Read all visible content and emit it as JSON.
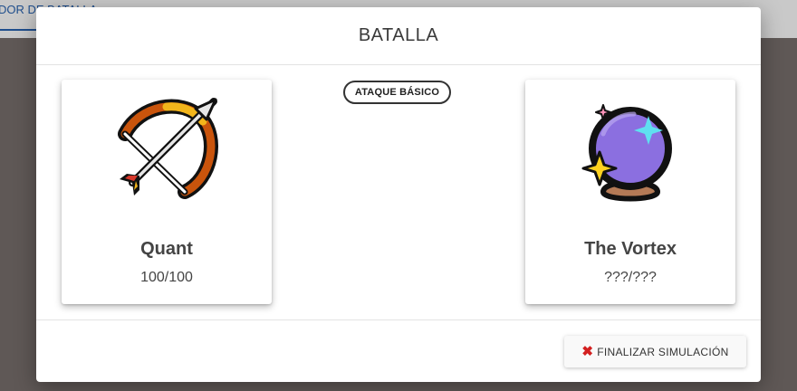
{
  "background": {
    "tab_label": "DOR DE BATALLA"
  },
  "modal": {
    "title": "BATALLA",
    "player": {
      "name": "Quant",
      "hp": "100/100",
      "icon": "bow-and-arrow-icon"
    },
    "enemy": {
      "name": "The Vortex",
      "hp": "???/???",
      "icon": "crystal-ball-icon"
    },
    "action_chip": "ATAQUE BÁSICO",
    "footer": {
      "finish_label": "FINALIZAR SIMULACIÓN",
      "finish_icon": "close-icon"
    }
  },
  "colors": {
    "overlay": "#5f5856",
    "modal_bg": "#ffffff",
    "finish_icon": "#d32020",
    "tab_accent": "#1f4e8c"
  }
}
